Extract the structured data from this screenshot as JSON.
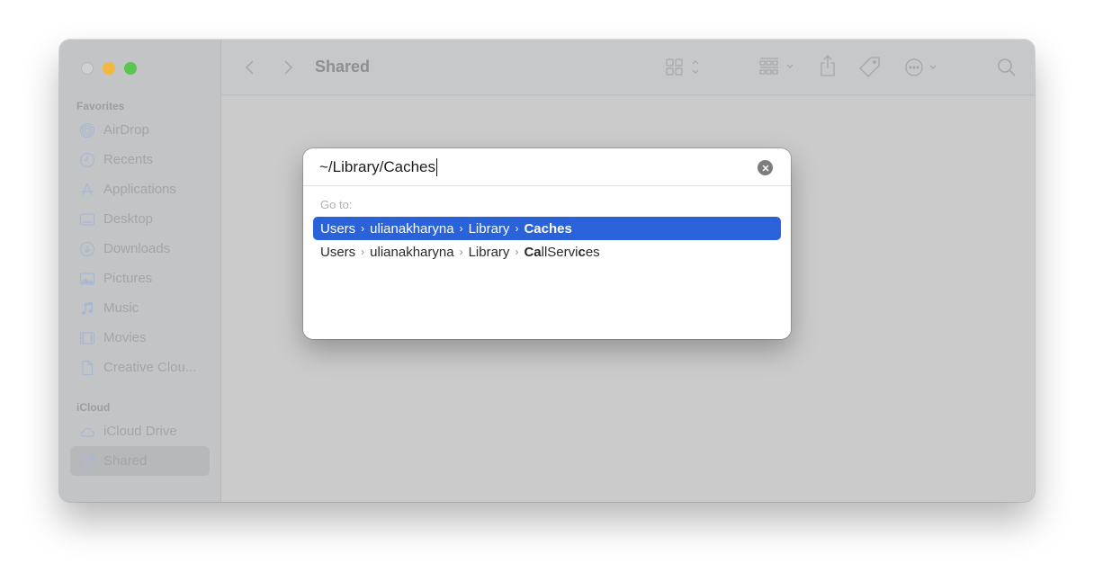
{
  "window": {
    "title": "Shared",
    "traffic_lights": {
      "close": "#d0d0d1",
      "minimize": "#f2b93d",
      "maximize": "#5ac64f"
    }
  },
  "sidebar": {
    "sections": [
      {
        "label": "Favorites",
        "items": [
          {
            "label": "AirDrop",
            "icon": "airdrop-icon"
          },
          {
            "label": "Recents",
            "icon": "clock-icon"
          },
          {
            "label": "Applications",
            "icon": "applications-icon"
          },
          {
            "label": "Desktop",
            "icon": "desktop-icon"
          },
          {
            "label": "Downloads",
            "icon": "download-icon"
          },
          {
            "label": "Pictures",
            "icon": "pictures-icon"
          },
          {
            "label": "Music",
            "icon": "music-note-icon"
          },
          {
            "label": "Movies",
            "icon": "film-icon"
          },
          {
            "label": "Creative Clou...",
            "icon": "document-icon"
          }
        ]
      },
      {
        "label": "iCloud",
        "items": [
          {
            "label": "iCloud Drive",
            "icon": "cloud-icon"
          },
          {
            "label": "Shared",
            "icon": "shared-folder-icon",
            "selected": true
          }
        ]
      }
    ]
  },
  "toolbar": {
    "back": "back-chevron-icon",
    "forward": "forward-chevron-icon",
    "title": "Shared",
    "buttons": [
      "view-grid-icon",
      "group-icon",
      "share-icon",
      "tag-icon",
      "more-actions-icon",
      "search-icon"
    ]
  },
  "goto_dialog": {
    "input_value": "~/Library/Caches",
    "label": "Go to:",
    "separator": "›",
    "accent": "#2a62d9",
    "results": [
      {
        "selected": true,
        "segments": [
          "Users",
          "ulianakharyna",
          "Library"
        ],
        "last": [
          {
            "t": "Caches",
            "b": true
          }
        ]
      },
      {
        "selected": false,
        "segments": [
          "Users",
          "ulianakharyna",
          "Library"
        ],
        "last": [
          {
            "t": "Ca",
            "b": true
          },
          {
            "t": "llServi",
            "b": false
          },
          {
            "t": "c",
            "b": true
          },
          {
            "t": "es",
            "b": false
          }
        ]
      }
    ]
  }
}
